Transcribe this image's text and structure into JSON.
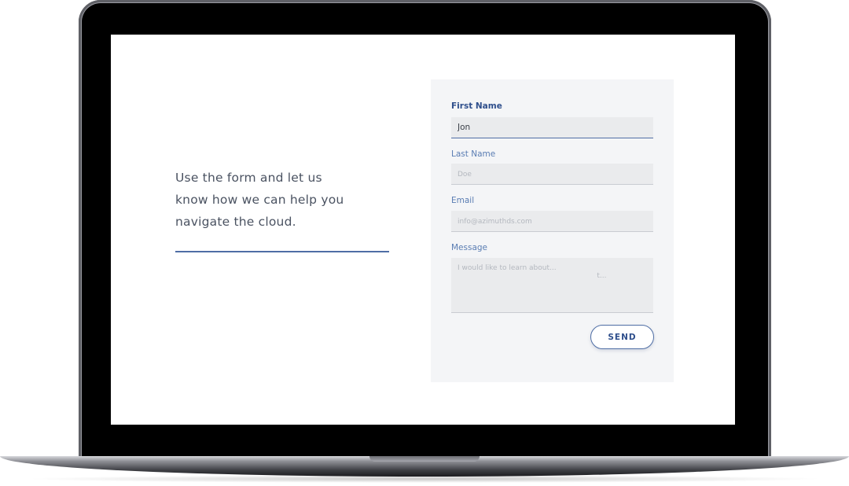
{
  "intro": {
    "text": "Use the form and let us\nknow how we can help you\nnavigate the cloud."
  },
  "form": {
    "first_name": {
      "label": "First Name",
      "value": "Jon",
      "placeholder": ""
    },
    "last_name": {
      "label": "Last Name",
      "value": "",
      "placeholder": "Doe"
    },
    "email": {
      "label": "Email",
      "value": "",
      "placeholder": "info@azimuthds.com"
    },
    "message": {
      "label": "Message",
      "value": "",
      "placeholder": "I would like to learn about...\n                                                              t..."
    },
    "send_label": "SEND"
  },
  "colors": {
    "accent": "#4f6ea5",
    "accent_dark": "#2f4f8c",
    "card_bg": "#f4f5f7",
    "input_bg": "#eaebed",
    "intro_text": "#4a5261"
  }
}
